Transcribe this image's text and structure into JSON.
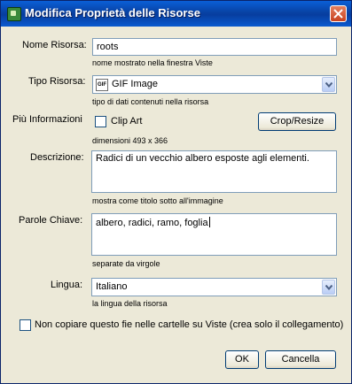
{
  "window": {
    "title": "Modifica Proprietà delle Risorse"
  },
  "form": {
    "nome": {
      "label": "Nome Risorsa:",
      "value": "roots",
      "hint": "nome mostrato nella finestra Viste"
    },
    "tipo": {
      "label": "Tipo Risorsa:",
      "value": "GIF Image",
      "icon_text": "GIF",
      "hint": "tipo di dati contenuti nella risorsa"
    },
    "info": {
      "label": "Più Informazioni",
      "clipart_label": "Clip Art",
      "crop_label": "Crop/Resize",
      "dimensions": "dimensioni 493 x 366"
    },
    "descrizione": {
      "label": "Descrizione:",
      "value": "Radici di un vecchio albero esposte agli elementi.",
      "hint": "mostra come titolo sotto all'immagine"
    },
    "parole": {
      "label": "Parole Chiave:",
      "value": "albero, radici, ramo, foglia",
      "hint": "separate da virgole"
    },
    "lingua": {
      "label": "Lingua:",
      "value": "Italiano",
      "hint": "la lingua della risorsa"
    },
    "nocopy": {
      "label": "Non copiare questo fie nelle cartelle su Viste (crea solo il collegamento)"
    }
  },
  "buttons": {
    "ok": "OK",
    "cancel": "Cancella"
  },
  "icons": {
    "app": "app-icon",
    "close": "close-icon",
    "dropdown": "chevron-down-icon",
    "file_type": "gif-file-icon"
  },
  "colors": {
    "titlebar": "#0842a4",
    "dialog_bg": "#ece9d8",
    "field_border": "#7f9db9",
    "close_button": "#c8421f"
  }
}
